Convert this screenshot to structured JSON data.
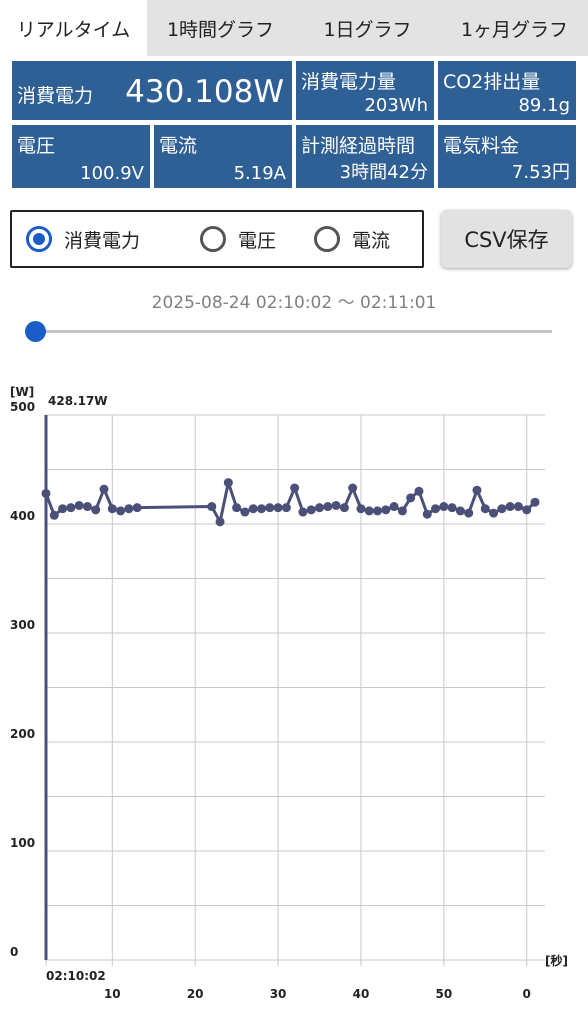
{
  "tabs": [
    "リアルタイム",
    "1時間グラフ",
    "1日グラフ",
    "1ヶ月グラフ"
  ],
  "stats": {
    "power": {
      "label": "消費電力",
      "value": "430.108W"
    },
    "energy": {
      "label": "消費電力量",
      "value": "203Wh"
    },
    "co2": {
      "label": "CO2排出量",
      "value": "89.1g"
    },
    "voltage": {
      "label": "電圧",
      "value": "100.9V"
    },
    "current": {
      "label": "電流",
      "value": "5.19A"
    },
    "elapsed": {
      "label": "計測経過時間",
      "value": "3時間42分"
    },
    "cost": {
      "label": "電気料金",
      "value": "7.53円"
    }
  },
  "radio": {
    "options": [
      "消費電力",
      "電圧",
      "電流"
    ],
    "selected": "消費電力"
  },
  "csv_button": "CSV保存",
  "range_text": "2025-08-24 02:10:02 〜 02:11:01",
  "slider": {
    "value": 0
  },
  "colors": {
    "accent": "#1a5cc8",
    "cell_bg": "#2e5f95",
    "line": "#4a5078"
  },
  "chart_data": {
    "type": "line",
    "ylabel": "[W]",
    "xlabel": "[秒]",
    "ylim": [
      0,
      500
    ],
    "yticks": [
      0,
      100,
      200,
      300,
      400,
      500
    ],
    "xlim": [
      0,
      59
    ],
    "xtick_labels": [
      "02:10:02",
      "10",
      "20",
      "30",
      "40",
      "50",
      "0"
    ],
    "xtick_positions": [
      0,
      8,
      18,
      28,
      38,
      48,
      58
    ],
    "grid": true,
    "cursor": {
      "x": 0,
      "label": "428.17W"
    },
    "series": [
      {
        "x": [
          0,
          1,
          2,
          3,
          4,
          5,
          6,
          7,
          8,
          9,
          10,
          11,
          20,
          21,
          22,
          23,
          24,
          25,
          26,
          27,
          28,
          29,
          30,
          31,
          32,
          33,
          34,
          35,
          36,
          37,
          38,
          39,
          40,
          41,
          42,
          43,
          44,
          45,
          46,
          47,
          48,
          49,
          50,
          51,
          52,
          53,
          54,
          55,
          56,
          57,
          58,
          59
        ],
        "values": [
          428,
          408,
          414,
          415,
          417,
          416,
          413,
          432,
          414,
          412,
          414,
          415,
          416,
          402,
          438,
          415,
          411,
          414,
          414,
          415,
          415,
          415,
          433,
          411,
          413,
          415,
          416,
          417,
          415,
          433,
          414,
          412,
          412,
          413,
          416,
          412,
          424,
          430,
          409,
          414,
          416,
          415,
          412,
          410,
          431,
          414,
          410,
          414,
          416,
          416,
          413,
          420
        ]
      }
    ]
  }
}
